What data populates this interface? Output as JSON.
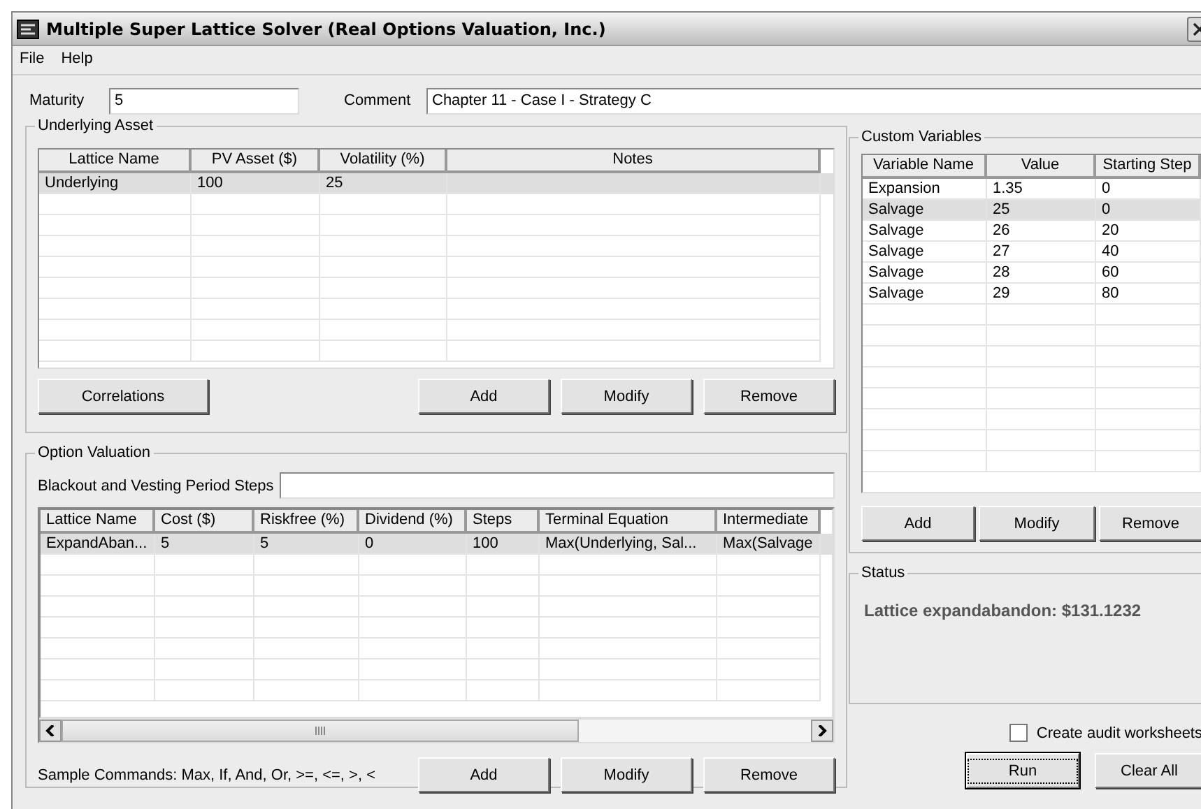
{
  "window": {
    "title": "Multiple Super Lattice Solver (Real Options Valuation, Inc.)"
  },
  "menu": [
    {
      "label": "File"
    },
    {
      "label": "Help"
    }
  ],
  "maturity": {
    "label": "Maturity",
    "value": "5"
  },
  "comment": {
    "label": "Comment",
    "value": "Chapter 11 - Case I - Strategy C"
  },
  "underlying_asset": {
    "title": "Underlying Asset",
    "columns": [
      "Lattice Name",
      "PV Asset ($)",
      "Volatility (%)",
      "Notes"
    ],
    "rows": [
      {
        "cells": [
          "Underlying",
          "100",
          "25",
          ""
        ],
        "selected": true
      }
    ],
    "buttons": [
      "Correlations",
      "Add",
      "Modify",
      "Remove"
    ]
  },
  "option_valuation": {
    "title": "Option Valuation",
    "blackout": {
      "label": "Blackout and Vesting Period Steps"
    },
    "columns": [
      "Lattice Name",
      "Cost ($)",
      "Riskfree (%)",
      "Dividend (%)",
      "Steps",
      "Terminal Equation",
      "Intermediate"
    ],
    "rows": [
      {
        "cells": [
          "ExpandAban...",
          "5",
          "5",
          "0",
          "100",
          "Max(Underlying, Sal...",
          "Max(Salvage"
        ],
        "selected": true
      }
    ],
    "sample_commands": "Sample Commands: Max, If, And, Or, >=, <=, >, <",
    "buttons": [
      "Add",
      "Modify",
      "Remove"
    ]
  },
  "custom_variables": {
    "title": "Custom Variables",
    "columns": [
      "Variable Name",
      "Value",
      "Starting Step"
    ],
    "rows": [
      {
        "cells": [
          "Expansion",
          "1.35",
          "0"
        ],
        "selected": false
      },
      {
        "cells": [
          "Salvage",
          "25",
          "0"
        ],
        "selected": true
      },
      {
        "cells": [
          "Salvage",
          "26",
          "20"
        ],
        "selected": false
      },
      {
        "cells": [
          "Salvage",
          "27",
          "40"
        ],
        "selected": false
      },
      {
        "cells": [
          "Salvage",
          "28",
          "60"
        ],
        "selected": false
      },
      {
        "cells": [
          "Salvage",
          "29",
          "80"
        ],
        "selected": false
      }
    ],
    "buttons": [
      "Add",
      "Modify",
      "Remove"
    ]
  },
  "status": {
    "title": "Status",
    "message": "Lattice expandabandon: $131.1232"
  },
  "create_audit_worksheets": {
    "label": "Create audit worksheets",
    "checked": false
  },
  "actions": [
    {
      "label": "Run",
      "default": true
    },
    {
      "label": "Clear All",
      "default": false
    }
  ]
}
